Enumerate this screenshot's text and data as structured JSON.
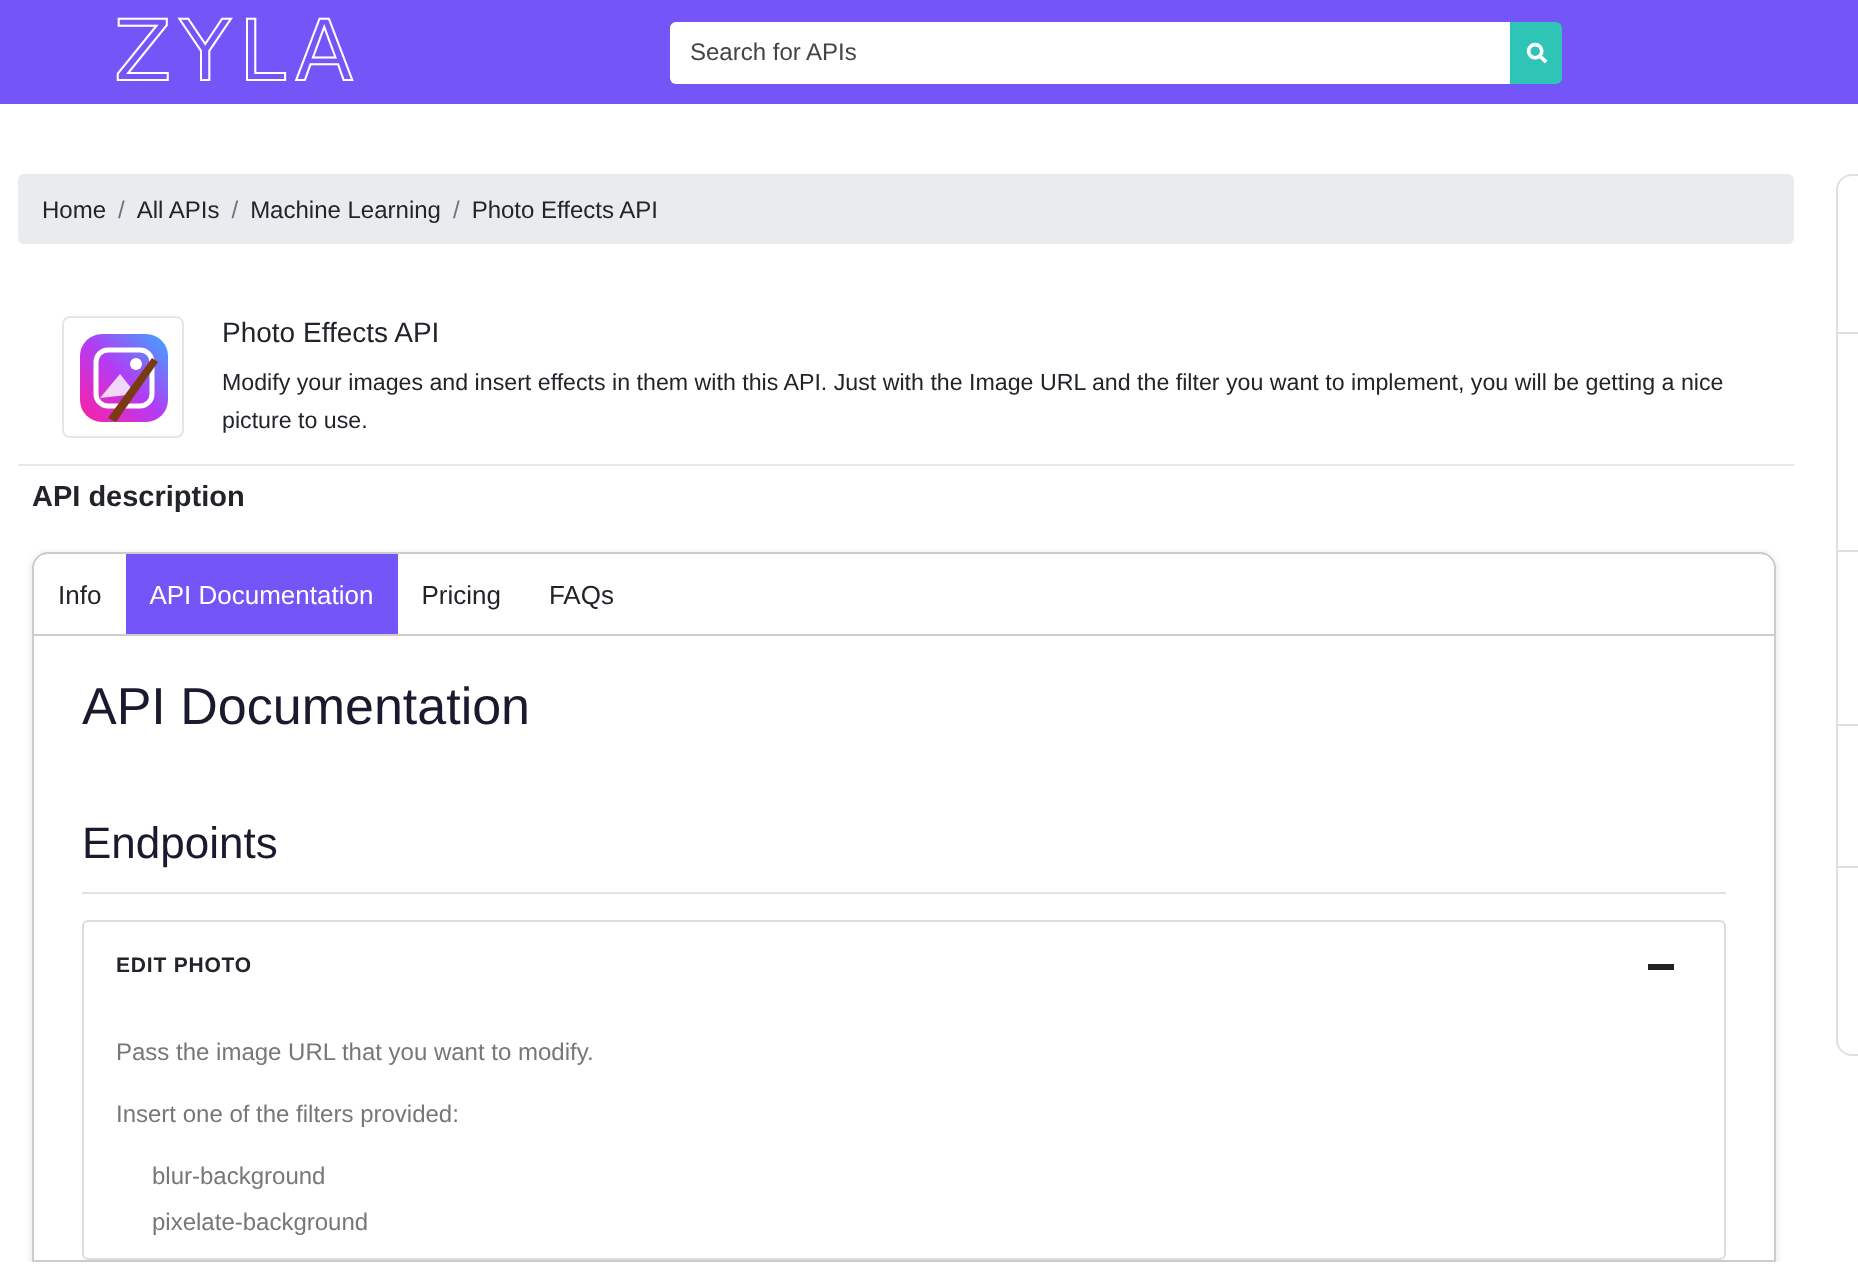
{
  "header": {
    "logo": "ZYLA",
    "search": {
      "placeholder": "Search for APIs"
    }
  },
  "breadcrumb": {
    "separator": "/",
    "items": [
      "Home",
      "All APIs",
      "Machine Learning",
      "Photo Effects API"
    ]
  },
  "product": {
    "title": "Photo Effects API",
    "description": "Modify your images and insert effects in them with this API. Just with the Image URL and the filter you want to implement, you will be getting a nice picture to use."
  },
  "section_title": "API description",
  "tabs": [
    {
      "label": "Info",
      "selected": false
    },
    {
      "label": "API Documentation",
      "selected": true
    },
    {
      "label": "Pricing",
      "selected": false
    },
    {
      "label": "FAQs",
      "selected": false
    }
  ],
  "doc": {
    "title": "API Documentation",
    "subtitle": "Endpoints",
    "endpoint": {
      "name": "EDIT PHOTO",
      "expanded": true,
      "paragraphs": [
        "Pass the image URL that you want to modify.",
        "Insert one of the filters provided:"
      ],
      "filters": [
        "blur-background",
        "pixelate-background"
      ]
    }
  }
}
